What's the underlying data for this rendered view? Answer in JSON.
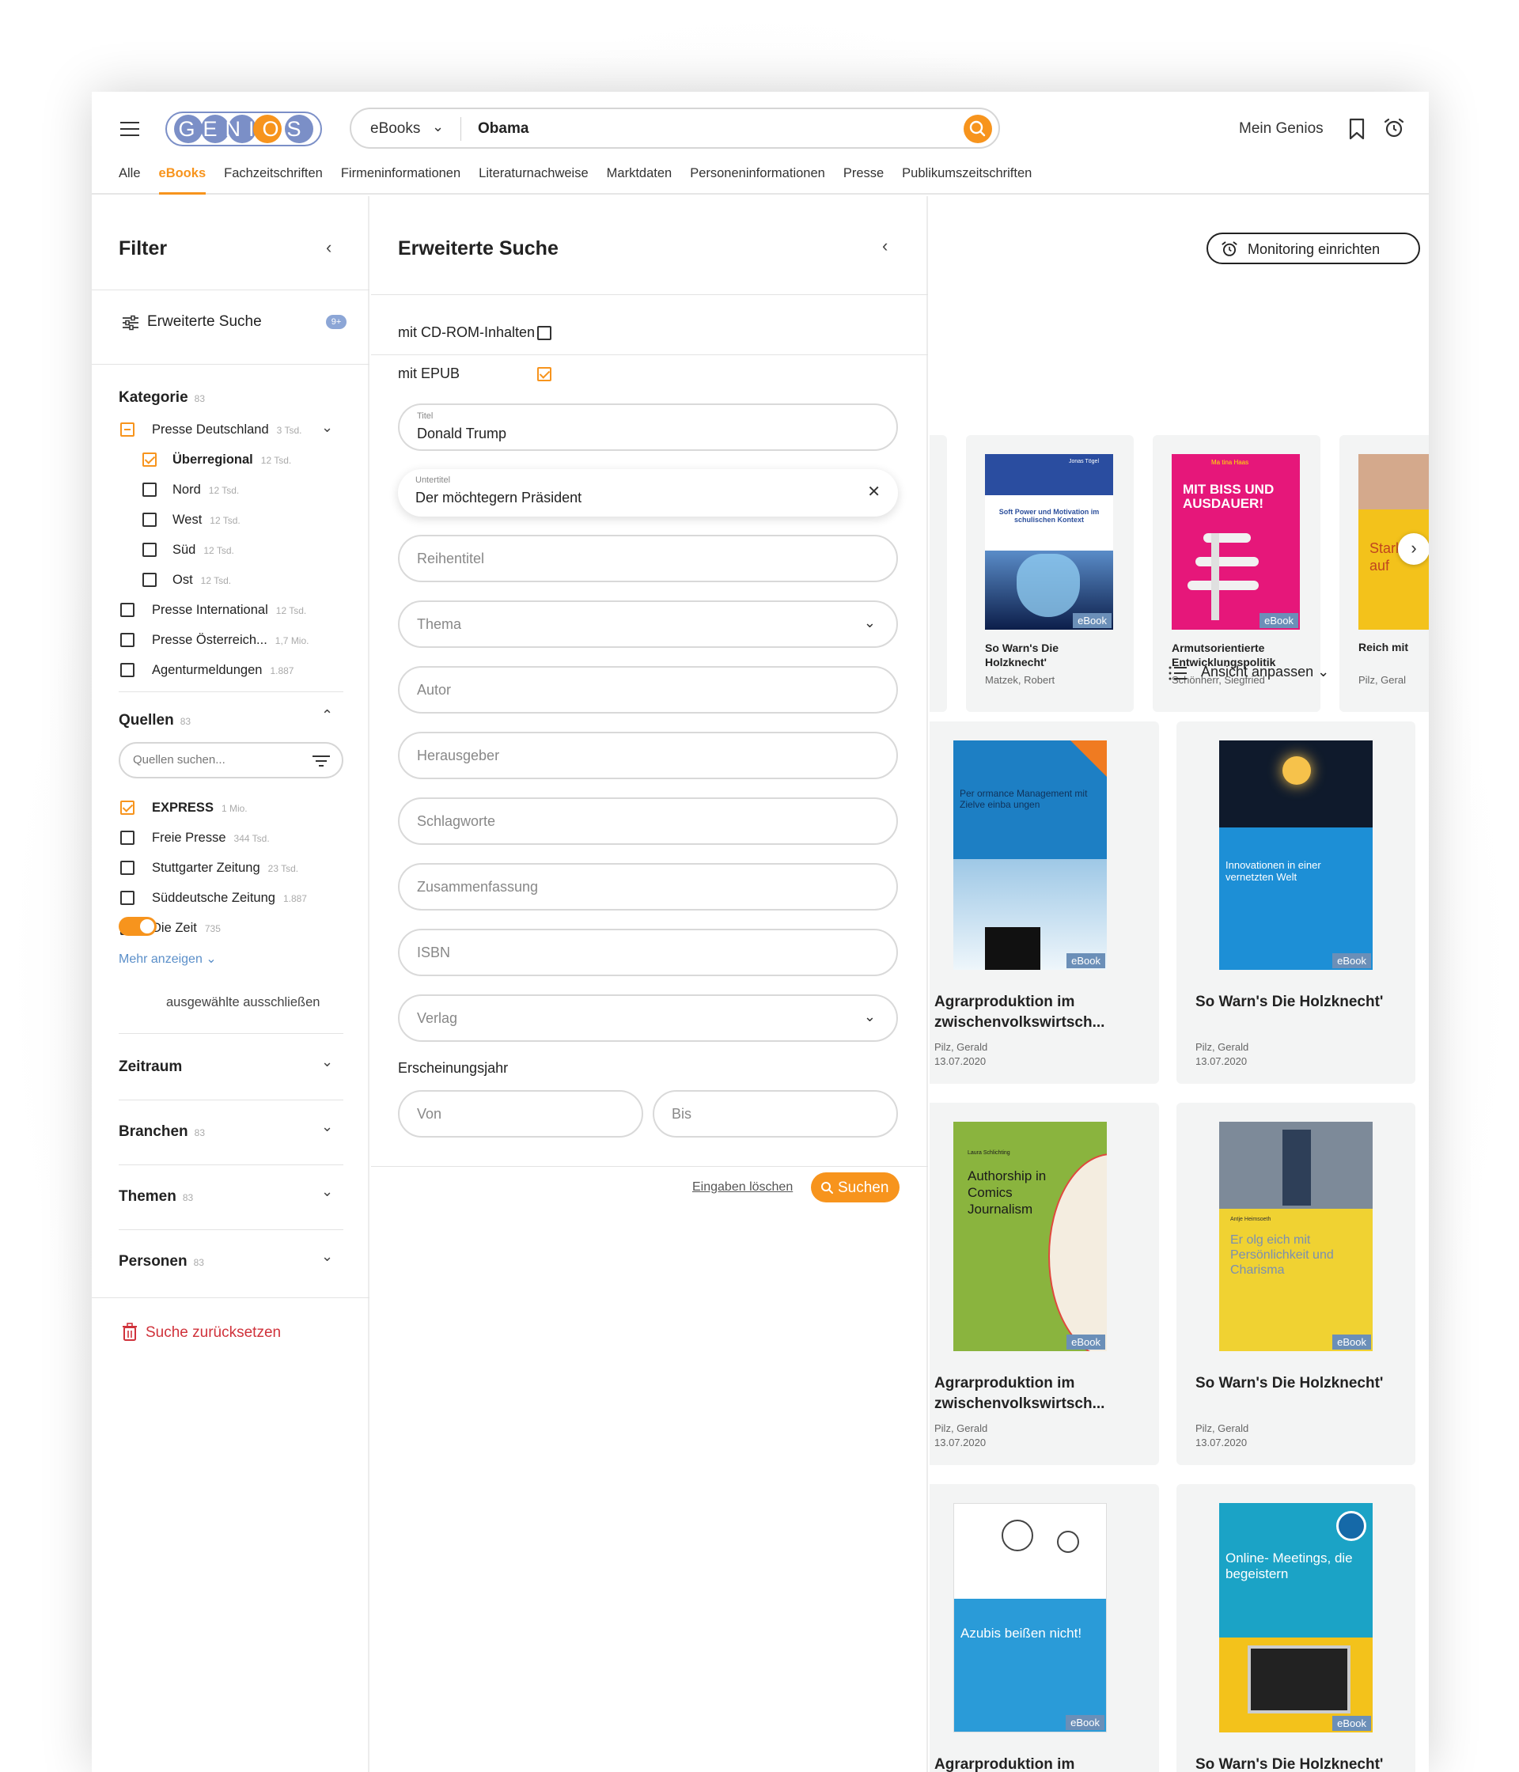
{
  "header": {
    "logo": "GENIOS",
    "search_scope": "eBooks",
    "search_value": "Obama",
    "account_label": "Mein Genios",
    "tabs": [
      "Alle",
      "eBooks",
      "Fachzeitschriften",
      "Firmeninformationen",
      "Literaturnachweise",
      "Marktdaten",
      "Personeninformationen",
      "Presse",
      "Publikumszeitschriften"
    ],
    "active_tab": "eBooks"
  },
  "filter": {
    "title": "Filter",
    "adv_search_label": "Erweiterte Suche",
    "adv_search_badge": "9+",
    "kategorie": {
      "title": "Kategorie",
      "count": "83",
      "items": [
        {
          "label": "Presse Deutschland",
          "count": "3 Tsd."
        },
        {
          "label": "Überregional",
          "count": "12 Tsd."
        },
        {
          "label": "Nord",
          "count": "12 Tsd."
        },
        {
          "label": "West",
          "count": "12 Tsd."
        },
        {
          "label": "Süd",
          "count": "12 Tsd."
        },
        {
          "label": "Ost",
          "count": "12 Tsd."
        },
        {
          "label": "Presse International",
          "count": "12 Tsd."
        },
        {
          "label": "Presse Österreich...",
          "count": "1,7 Mio."
        },
        {
          "label": "Agenturmeldungen",
          "count": "1.887"
        }
      ]
    },
    "quellen": {
      "title": "Quellen",
      "count": "83",
      "search_placeholder": "Quellen suchen...",
      "items": [
        {
          "label": "EXPRESS",
          "count": "1 Mio."
        },
        {
          "label": "Freie Presse",
          "count": "344 Tsd."
        },
        {
          "label": "Stuttgarter Zeitung",
          "count": "23 Tsd."
        },
        {
          "label": "Süddeutsche Zeitung",
          "count": "1.887"
        },
        {
          "label": "Die Zeit",
          "count": "735"
        }
      ],
      "more": "Mehr anzeigen",
      "exclude_label": "ausgewählte ausschließen"
    },
    "collapsed": [
      {
        "title": "Zeitraum",
        "count": ""
      },
      {
        "title": "Branchen",
        "count": "83"
      },
      {
        "title": "Themen",
        "count": "83"
      },
      {
        "title": "Personen",
        "count": "83"
      }
    ],
    "reset": "Suche zurücksetzen"
  },
  "advanced": {
    "title": "Erweiterte Suche",
    "cd_rom": "mit CD-ROM-Inhalten",
    "epub": "mit EPUB",
    "titel_label": "Titel",
    "titel_value": "Donald Trump",
    "untertitel_label": "Untertitel",
    "untertitel_value": "Der möchtegern Präsident",
    "placeholders": {
      "reihentitel": "Reihentitel",
      "thema": "Thema",
      "autor": "Autor",
      "herausgeber": "Herausgeber",
      "schlagworte": "Schlagworte",
      "zusammenfassung": "Zusammenfassung",
      "isbn": "ISBN",
      "verlag": "Verlag",
      "von": "Von",
      "bis": "Bis"
    },
    "year_label": "Erscheinungsjahr",
    "clear": "Eingaben löschen",
    "submit": "Suchen"
  },
  "results": {
    "monitoring": "Monitoring einrichten",
    "view": "Ansicht anpassen",
    "badge": "eBook",
    "carousel": [
      {
        "title": "So Warn's Die Holzknecht'",
        "author": "Matzek, Robert",
        "cover_text": "Soft Power und Motivation im schulischen Kontext",
        "cover_author": "Jonas Tögel"
      },
      {
        "title": "Armutsorientierte Entwicklungspolitik",
        "author": "Schönherr, Siegfried",
        "cover_text": "MIT BISS UND AUSDAUER!",
        "cover_author": "Ma tina Haas"
      },
      {
        "title": "Reich mit",
        "author": "Pilz, Geral",
        "cover_text": "Stark u auf"
      }
    ],
    "grid": [
      {
        "title": "Agrarproduktion im zwischenvolkswirtsch...",
        "author": "Pilz, Gerald",
        "date": "13.07.2020",
        "cover_text": "Per ormance Management mit Zielve einba ungen"
      },
      {
        "title": "So Warn's Die Holzknecht'",
        "author": "Pilz, Gerald",
        "date": "13.07.2020",
        "cover_text": "Innovationen in einer vernetzten Welt"
      },
      {
        "title": "Agrarproduktion im zwischenvolkswirtsch...",
        "author": "Pilz, Gerald",
        "date": "13.07.2020",
        "cover_text": "Authorship in Comics Journalism",
        "cover_author": "Laura Schlichting"
      },
      {
        "title": "So Warn's Die Holzknecht'",
        "author": "Pilz, Gerald",
        "date": "13.07.2020",
        "cover_text": "Er olg eich mit Persönlichkeit und Charisma",
        "cover_author": "Antje Heimsoeth"
      },
      {
        "title": "Agrarproduktion im zwischenvolkswirtsch...",
        "author": "",
        "date": "",
        "cover_text": "Azubis beißen nicht!"
      },
      {
        "title": "So Warn's Die Holzknecht'",
        "author": "",
        "date": "",
        "cover_text": "Online- Meetings, die begeistern"
      }
    ]
  },
  "colors": {
    "accent": "#f7941d",
    "link": "#5b8fc9",
    "danger": "#d0323b",
    "badge": "#6b8fb8"
  }
}
